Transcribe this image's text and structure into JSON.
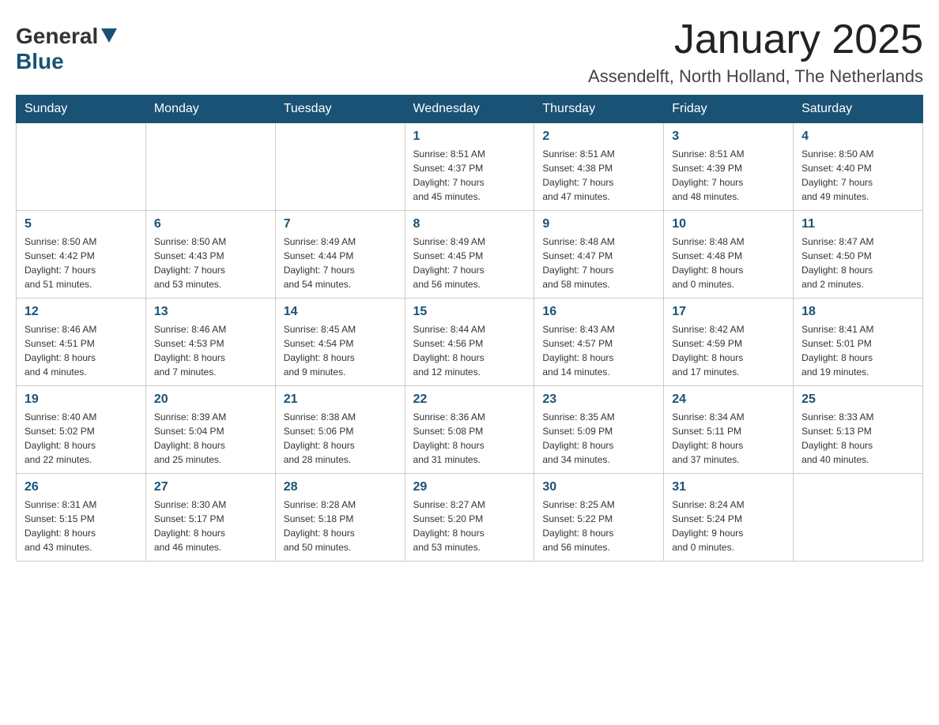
{
  "logo": {
    "general": "General",
    "blue": "Blue"
  },
  "title": {
    "month_year": "January 2025",
    "location": "Assendelft, North Holland, The Netherlands"
  },
  "headers": [
    "Sunday",
    "Monday",
    "Tuesday",
    "Wednesday",
    "Thursday",
    "Friday",
    "Saturday"
  ],
  "weeks": [
    [
      {
        "day": "",
        "info": ""
      },
      {
        "day": "",
        "info": ""
      },
      {
        "day": "",
        "info": ""
      },
      {
        "day": "1",
        "info": "Sunrise: 8:51 AM\nSunset: 4:37 PM\nDaylight: 7 hours\nand 45 minutes."
      },
      {
        "day": "2",
        "info": "Sunrise: 8:51 AM\nSunset: 4:38 PM\nDaylight: 7 hours\nand 47 minutes."
      },
      {
        "day": "3",
        "info": "Sunrise: 8:51 AM\nSunset: 4:39 PM\nDaylight: 7 hours\nand 48 minutes."
      },
      {
        "day": "4",
        "info": "Sunrise: 8:50 AM\nSunset: 4:40 PM\nDaylight: 7 hours\nand 49 minutes."
      }
    ],
    [
      {
        "day": "5",
        "info": "Sunrise: 8:50 AM\nSunset: 4:42 PM\nDaylight: 7 hours\nand 51 minutes."
      },
      {
        "day": "6",
        "info": "Sunrise: 8:50 AM\nSunset: 4:43 PM\nDaylight: 7 hours\nand 53 minutes."
      },
      {
        "day": "7",
        "info": "Sunrise: 8:49 AM\nSunset: 4:44 PM\nDaylight: 7 hours\nand 54 minutes."
      },
      {
        "day": "8",
        "info": "Sunrise: 8:49 AM\nSunset: 4:45 PM\nDaylight: 7 hours\nand 56 minutes."
      },
      {
        "day": "9",
        "info": "Sunrise: 8:48 AM\nSunset: 4:47 PM\nDaylight: 7 hours\nand 58 minutes."
      },
      {
        "day": "10",
        "info": "Sunrise: 8:48 AM\nSunset: 4:48 PM\nDaylight: 8 hours\nand 0 minutes."
      },
      {
        "day": "11",
        "info": "Sunrise: 8:47 AM\nSunset: 4:50 PM\nDaylight: 8 hours\nand 2 minutes."
      }
    ],
    [
      {
        "day": "12",
        "info": "Sunrise: 8:46 AM\nSunset: 4:51 PM\nDaylight: 8 hours\nand 4 minutes."
      },
      {
        "day": "13",
        "info": "Sunrise: 8:46 AM\nSunset: 4:53 PM\nDaylight: 8 hours\nand 7 minutes."
      },
      {
        "day": "14",
        "info": "Sunrise: 8:45 AM\nSunset: 4:54 PM\nDaylight: 8 hours\nand 9 minutes."
      },
      {
        "day": "15",
        "info": "Sunrise: 8:44 AM\nSunset: 4:56 PM\nDaylight: 8 hours\nand 12 minutes."
      },
      {
        "day": "16",
        "info": "Sunrise: 8:43 AM\nSunset: 4:57 PM\nDaylight: 8 hours\nand 14 minutes."
      },
      {
        "day": "17",
        "info": "Sunrise: 8:42 AM\nSunset: 4:59 PM\nDaylight: 8 hours\nand 17 minutes."
      },
      {
        "day": "18",
        "info": "Sunrise: 8:41 AM\nSunset: 5:01 PM\nDaylight: 8 hours\nand 19 minutes."
      }
    ],
    [
      {
        "day": "19",
        "info": "Sunrise: 8:40 AM\nSunset: 5:02 PM\nDaylight: 8 hours\nand 22 minutes."
      },
      {
        "day": "20",
        "info": "Sunrise: 8:39 AM\nSunset: 5:04 PM\nDaylight: 8 hours\nand 25 minutes."
      },
      {
        "day": "21",
        "info": "Sunrise: 8:38 AM\nSunset: 5:06 PM\nDaylight: 8 hours\nand 28 minutes."
      },
      {
        "day": "22",
        "info": "Sunrise: 8:36 AM\nSunset: 5:08 PM\nDaylight: 8 hours\nand 31 minutes."
      },
      {
        "day": "23",
        "info": "Sunrise: 8:35 AM\nSunset: 5:09 PM\nDaylight: 8 hours\nand 34 minutes."
      },
      {
        "day": "24",
        "info": "Sunrise: 8:34 AM\nSunset: 5:11 PM\nDaylight: 8 hours\nand 37 minutes."
      },
      {
        "day": "25",
        "info": "Sunrise: 8:33 AM\nSunset: 5:13 PM\nDaylight: 8 hours\nand 40 minutes."
      }
    ],
    [
      {
        "day": "26",
        "info": "Sunrise: 8:31 AM\nSunset: 5:15 PM\nDaylight: 8 hours\nand 43 minutes."
      },
      {
        "day": "27",
        "info": "Sunrise: 8:30 AM\nSunset: 5:17 PM\nDaylight: 8 hours\nand 46 minutes."
      },
      {
        "day": "28",
        "info": "Sunrise: 8:28 AM\nSunset: 5:18 PM\nDaylight: 8 hours\nand 50 minutes."
      },
      {
        "day": "29",
        "info": "Sunrise: 8:27 AM\nSunset: 5:20 PM\nDaylight: 8 hours\nand 53 minutes."
      },
      {
        "day": "30",
        "info": "Sunrise: 8:25 AM\nSunset: 5:22 PM\nDaylight: 8 hours\nand 56 minutes."
      },
      {
        "day": "31",
        "info": "Sunrise: 8:24 AM\nSunset: 5:24 PM\nDaylight: 9 hours\nand 0 minutes."
      },
      {
        "day": "",
        "info": ""
      }
    ]
  ]
}
